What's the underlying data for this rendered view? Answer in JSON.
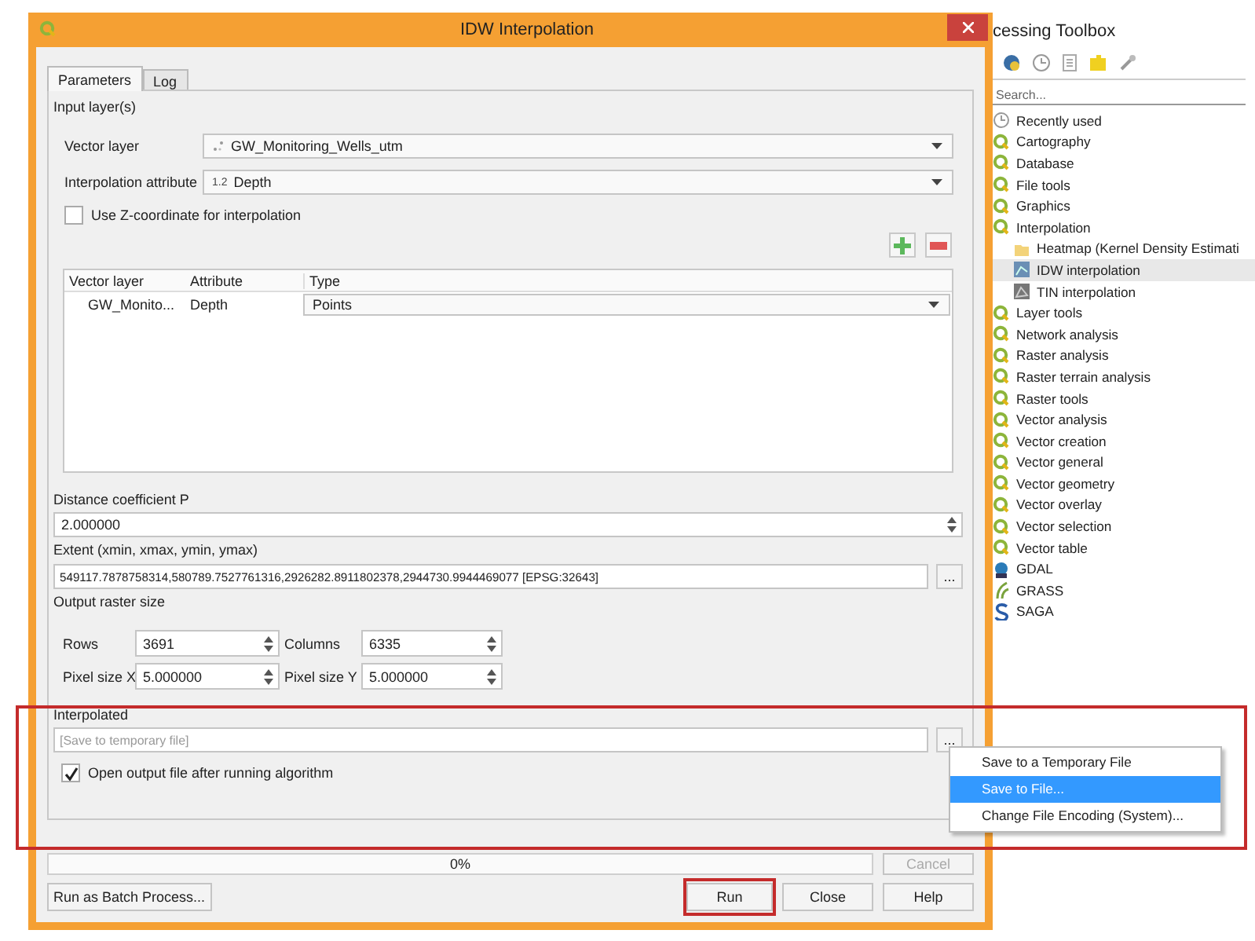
{
  "window": {
    "title": "IDW Interpolation"
  },
  "tabs": [
    {
      "label": "Parameters",
      "selected": true
    },
    {
      "label": "Log",
      "selected": false
    }
  ],
  "input_layers": {
    "label": "Input layer(s)",
    "vector_layer": {
      "label": "Vector layer",
      "value": "GW_Monitoring_Wells_utm"
    },
    "interpolation_attribute": {
      "label": "Interpolation attribute",
      "type_badge": "1.2",
      "value": "Depth"
    },
    "use_z": {
      "label": "Use Z-coordinate for interpolation",
      "checked": false
    }
  },
  "layers_table": {
    "columns": [
      "Vector layer",
      "Attribute",
      "Type"
    ],
    "rows": [
      {
        "vector_layer": "GW_Monito...",
        "attribute": "Depth",
        "type": "Points"
      }
    ]
  },
  "distance_coefficient": {
    "label": "Distance coefficient P",
    "value": "2.000000"
  },
  "extent": {
    "label": "Extent (xmin, xmax, ymin, ymax)",
    "value": "549117.7878758314,580789.7527761316,2926282.8911802378,2944730.9944469077 [EPSG:32643]",
    "button": "..."
  },
  "output_raster_size": {
    "label": "Output raster size",
    "fields": [
      {
        "label": "Rows",
        "value": "3691"
      },
      {
        "label": "Columns",
        "value": "6335"
      },
      {
        "label": "Pixel size X",
        "value": "5.000000"
      },
      {
        "label": "Pixel size Y",
        "value": "5.000000"
      }
    ]
  },
  "interpolated": {
    "label": "Interpolated",
    "placeholder": "[Save to temporary file]",
    "button": "...",
    "highlighted": true,
    "open_after": {
      "label": "Open output file after running algorithm",
      "checked": true
    }
  },
  "progress": {
    "label": "0%",
    "level": 0,
    "cancel": {
      "label": "Cancel",
      "disabled": true
    }
  },
  "buttons": [
    {
      "label": "Run as Batch Process...",
      "highlighted": false
    },
    {
      "label": "Run",
      "highlighted": true
    },
    {
      "label": "Close",
      "highlighted": false
    },
    {
      "label": "Help",
      "highlighted": false
    }
  ],
  "context_menu": {
    "items": [
      {
        "label": "Save to a Temporary File",
        "selected": false
      },
      {
        "label": "Save to File...",
        "selected": true
      },
      {
        "label": "Change File Encoding (System)...",
        "selected": false
      }
    ]
  },
  "toolbox": {
    "title": "cessing Toolbox",
    "search": {
      "placeholder": "Search..."
    },
    "items": [
      {
        "label": "Recently used",
        "kind": "recent",
        "selected": false
      },
      {
        "label": "Cartography",
        "kind": "qgis",
        "selected": false
      },
      {
        "label": "Database",
        "kind": "qgis",
        "selected": false
      },
      {
        "label": "File tools",
        "kind": "qgis",
        "selected": false
      },
      {
        "label": "Graphics",
        "kind": "qgis",
        "selected": false
      },
      {
        "label": "Interpolation",
        "kind": "qgis",
        "selected": false,
        "children": [
          {
            "label": "Heatmap (Kernel Density Estimati",
            "kind": "heatmap",
            "selected": false
          },
          {
            "label": "IDW interpolation",
            "kind": "idw",
            "selected": true
          },
          {
            "label": "TIN interpolation",
            "kind": "tin",
            "selected": false
          }
        ]
      },
      {
        "label": "Layer tools",
        "kind": "qgis",
        "selected": false
      },
      {
        "label": "Network analysis",
        "kind": "qgis",
        "selected": false
      },
      {
        "label": "Raster analysis",
        "kind": "qgis",
        "selected": false
      },
      {
        "label": "Raster terrain analysis",
        "kind": "qgis",
        "selected": false
      },
      {
        "label": "Raster tools",
        "kind": "qgis",
        "selected": false
      },
      {
        "label": "Vector analysis",
        "kind": "qgis",
        "selected": false
      },
      {
        "label": "Vector creation",
        "kind": "qgis",
        "selected": false
      },
      {
        "label": "Vector general",
        "kind": "qgis",
        "selected": false
      },
      {
        "label": "Vector geometry",
        "kind": "qgis",
        "selected": false
      },
      {
        "label": "Vector overlay",
        "kind": "qgis",
        "selected": false
      },
      {
        "label": "Vector selection",
        "kind": "qgis",
        "selected": false
      },
      {
        "label": "Vector table",
        "kind": "qgis",
        "selected": false
      },
      {
        "label": "GDAL",
        "kind": "gdal",
        "selected": false
      },
      {
        "label": "GRASS",
        "kind": "grass",
        "selected": false
      },
      {
        "label": "SAGA",
        "kind": "saga",
        "selected": false
      }
    ]
  }
}
